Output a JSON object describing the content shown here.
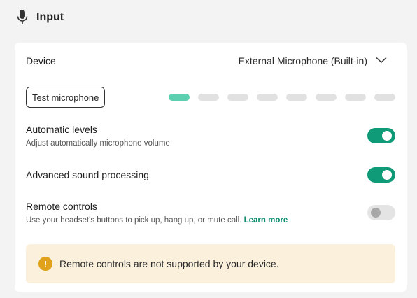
{
  "section": {
    "title": "Input",
    "icon": "microphone-icon"
  },
  "device": {
    "label": "Device",
    "value": "External Microphone (Built-in)",
    "icon": "chevron-down-icon"
  },
  "test": {
    "button_label": "Test microphone",
    "meter_level": 0.125,
    "meter_segments": 8,
    "accent": "#5ccfb0"
  },
  "settings": [
    {
      "title": "Automatic levels",
      "description": "Adjust automatically microphone volume",
      "enabled": true
    },
    {
      "title": "Advanced sound processing",
      "description": "",
      "enabled": true
    },
    {
      "title": "Remote controls",
      "description": "Use your headset's buttons to pick up, hang up, or mute call.",
      "link": "Learn more",
      "enabled": false
    }
  ],
  "notice": {
    "text": "Remote controls are not supported by your device.",
    "icon": "warning-icon"
  },
  "colors": {
    "toggle_on": "#0f9b78",
    "toggle_off": "#e4e4e4",
    "link": "#0d8d6e",
    "warning": "#e0a21b",
    "notice_bg": "#fbf0dc"
  }
}
